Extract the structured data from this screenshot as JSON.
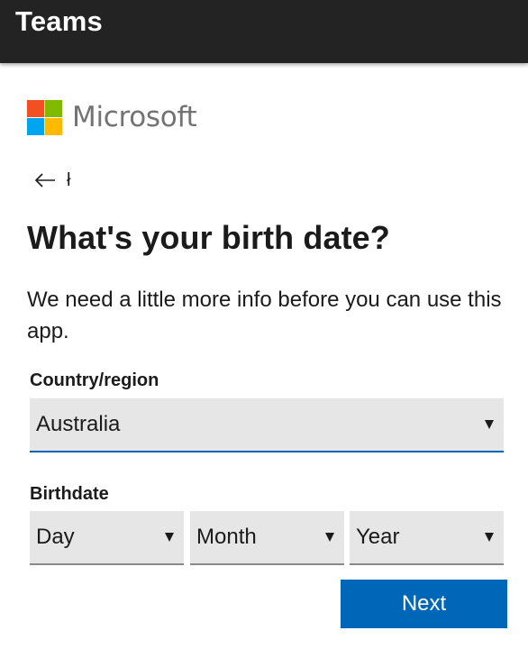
{
  "app_bar": {
    "title": "Teams"
  },
  "brand": {
    "name": "Microsoft",
    "logo_colors": [
      "#f25022",
      "#7fba00",
      "#00a4ef",
      "#ffb900"
    ]
  },
  "back": {
    "icon": "arrow-left-icon",
    "trail_text": "ł"
  },
  "heading": "What's your birth date?",
  "description": "We need a little more info before you can use this app.",
  "country": {
    "label": "Country/region",
    "selected": "Australia"
  },
  "birthdate": {
    "label": "Birthdate",
    "day": "Day",
    "month": "Month",
    "year": "Year"
  },
  "next_button": "Next",
  "colors": {
    "app_bar_bg": "#232323",
    "accent": "#0067b8",
    "select_bg": "#e6e6e6",
    "brand_text": "#737373"
  }
}
